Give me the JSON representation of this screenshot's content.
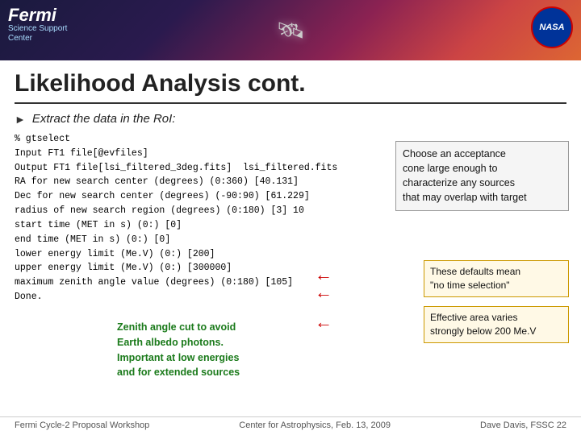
{
  "header": {
    "fermi_title": "Fermi",
    "support_line1": "Science Support",
    "support_line2": "Center",
    "nasa_label": "NASA"
  },
  "page": {
    "title": "Likelihood Analysis cont.",
    "section_label": "Extract the data in the RoI:"
  },
  "code": {
    "lines": [
      "% gtselect",
      "Input FT1 file[@evfiles]",
      "Output FT1 file[lsi_filtered_3deg.fits]  lsi_filtered.fits",
      "RA for new search center (degrees) (0:360) [40.131]",
      "Dec for new search center (degrees) (-90:90) [61.229]",
      "radius of new search region (degrees) (0:180) [3] 10",
      "start time (MET in s) (0:) [0]",
      "end time (MET in s) (0:) [0]",
      "lower energy limit (Me.V) (0:) [200]",
      "upper energy limit (Me.V) (0:) [300000]",
      "maximum zenith angle value (degrees) (0:180) [105]",
      "Done."
    ]
  },
  "callouts": {
    "top_right": {
      "line1": "Choose an acceptance",
      "line2": "cone large enough to",
      "line3": "characterize any sources",
      "line4": "that may overlap with target"
    },
    "mid_right": {
      "line1": "These defaults mean",
      "line2": "\"no time selection\""
    },
    "lower_right": {
      "line1": "Effective area varies",
      "line2": "strongly below 200 Me.V"
    },
    "zenith": {
      "line1": "Zenith angle cut to avoid",
      "line2": "Earth albedo photons.",
      "line3": "Important at low energies",
      "line4": "and for extended sources"
    }
  },
  "footer": {
    "left": "Fermi Cycle-2 Proposal Workshop",
    "center": "Center for Astrophysics, Feb. 13, 2009",
    "right": "Dave Davis, FSSC 22"
  }
}
